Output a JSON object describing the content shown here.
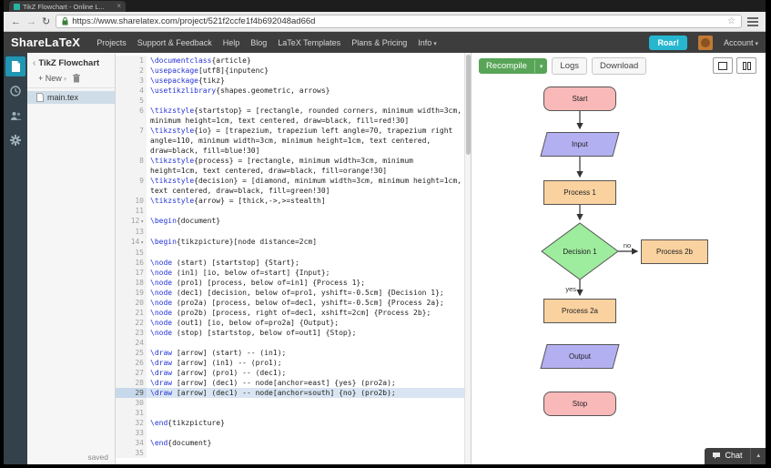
{
  "browser": {
    "tab_title": "TikZ Flowchart - Online L...",
    "url": "https://www.sharelatex.com/project/521f2ccfe1f4b692048ad66d"
  },
  "navbar": {
    "brand": "ShareLaTeX",
    "menu": [
      "Projects",
      "Support & Feedback",
      "Help",
      "Blog",
      "LaTeX Templates",
      "Plans & Pricing",
      "Info"
    ],
    "roar": "Roar!",
    "account": "Account"
  },
  "sidebar": {
    "icons": [
      "files",
      "history",
      "collaborators",
      "settings"
    ]
  },
  "file_panel": {
    "project_name": "TikZ Flowchart",
    "new_button": "+ New",
    "files": [
      "main.tex"
    ],
    "save_status": "saved"
  },
  "editor": {
    "active_line": 29,
    "lines": [
      {
        "n": 1,
        "t": "\\documentclass{article}"
      },
      {
        "n": 2,
        "t": "\\usepackage[utf8]{inputenc}"
      },
      {
        "n": 3,
        "t": "\\usepackage{tikz}"
      },
      {
        "n": 4,
        "t": "\\usetikzlibrary{shapes.geometric, arrows}"
      },
      {
        "n": 5,
        "t": ""
      },
      {
        "n": 6,
        "t": "\\tikzstyle{startstop} = [rectangle, rounded corners, minimum width=3cm, minimum height=1cm, text centered, draw=black, fill=red!30]"
      },
      {
        "n": 7,
        "t": "\\tikzstyle{io} = [trapezium, trapezium left angle=70, trapezium right angle=110, minimum width=3cm, minimum height=1cm, text centered, draw=black, fill=blue!30]"
      },
      {
        "n": 8,
        "t": "\\tikzstyle{process} = [rectangle, minimum width=3cm, minimum height=1cm, text centered, draw=black, fill=orange!30]"
      },
      {
        "n": 9,
        "t": "\\tikzstyle{decision} = [diamond, minimum width=3cm, minimum height=1cm, text centered, draw=black, fill=green!30]"
      },
      {
        "n": 10,
        "t": "\\tikzstyle{arrow} = [thick,->,>=stealth]"
      },
      {
        "n": 11,
        "t": ""
      },
      {
        "n": 12,
        "t": "\\begin{document}",
        "fold": true
      },
      {
        "n": 13,
        "t": ""
      },
      {
        "n": 14,
        "t": "\\begin{tikzpicture}[node distance=2cm]",
        "fold": true
      },
      {
        "n": 15,
        "t": ""
      },
      {
        "n": 16,
        "t": "\\node (start) [startstop] {Start};"
      },
      {
        "n": 17,
        "t": "\\node (in1) [io, below of=start] {Input};"
      },
      {
        "n": 18,
        "t": "\\node (pro1) [process, below of=in1] {Process 1};"
      },
      {
        "n": 19,
        "t": "\\node (dec1) [decision, below of=pro1, yshift=-0.5cm] {Decision 1};"
      },
      {
        "n": 20,
        "t": "\\node (pro2a) [process, below of=dec1, yshift=-0.5cm] {Process 2a};"
      },
      {
        "n": 21,
        "t": "\\node (pro2b) [process, right of=dec1, xshift=2cm] {Process 2b};"
      },
      {
        "n": 22,
        "t": "\\node (out1) [io, below of=pro2a] {Output};"
      },
      {
        "n": 23,
        "t": "\\node (stop) [startstop, below of=out1] {Stop};"
      },
      {
        "n": 24,
        "t": ""
      },
      {
        "n": 25,
        "t": "\\draw [arrow] (start) -- (in1);"
      },
      {
        "n": 26,
        "t": "\\draw [arrow] (in1) -- (pro1);"
      },
      {
        "n": 27,
        "t": "\\draw [arrow] (pro1) -- (dec1);"
      },
      {
        "n": 28,
        "t": "\\draw [arrow] (dec1) -- node[anchor=east] {yes} (pro2a);"
      },
      {
        "n": 29,
        "t": "\\draw [arrow] (dec1) -- node[anchor=south] {no} (pro2b);"
      },
      {
        "n": 30,
        "t": ""
      },
      {
        "n": 31,
        "t": ""
      },
      {
        "n": 32,
        "t": "\\end{tikzpicture}"
      },
      {
        "n": 33,
        "t": ""
      },
      {
        "n": 34,
        "t": "\\end{document}"
      },
      {
        "n": 35,
        "t": ""
      }
    ]
  },
  "preview": {
    "recompile": "Recompile",
    "logs": "Logs",
    "download": "Download",
    "chat": "Chat"
  },
  "flowchart": {
    "nodes": [
      {
        "id": "start",
        "label": "Start",
        "shape": "rounded-rect",
        "fill": "#f9b9b9"
      },
      {
        "id": "in1",
        "label": "Input",
        "shape": "parallelogram",
        "fill": "#b3b0f2"
      },
      {
        "id": "pro1",
        "label": "Process 1",
        "shape": "rect",
        "fill": "#fad2a0"
      },
      {
        "id": "dec1",
        "label": "Decision 1",
        "shape": "diamond",
        "fill": "#9eec9e"
      },
      {
        "id": "pro2b",
        "label": "Process 2b",
        "shape": "rect",
        "fill": "#fad2a0"
      },
      {
        "id": "pro2a",
        "label": "Process 2a",
        "shape": "rect",
        "fill": "#fad2a0"
      },
      {
        "id": "out1",
        "label": "Output",
        "shape": "parallelogram",
        "fill": "#b3b0f2"
      },
      {
        "id": "stop",
        "label": "Stop",
        "shape": "rounded-rect",
        "fill": "#f9b9b9"
      }
    ],
    "edges": [
      {
        "from": "start",
        "to": "in1",
        "label": ""
      },
      {
        "from": "in1",
        "to": "pro1",
        "label": ""
      },
      {
        "from": "pro1",
        "to": "dec1",
        "label": ""
      },
      {
        "from": "dec1",
        "to": "pro2a",
        "label": "yes"
      },
      {
        "from": "dec1",
        "to": "pro2b",
        "label": "no"
      }
    ]
  },
  "colors": {
    "accent_teal": "#26b6cf",
    "recompile_green": "#58a558",
    "navbar_bg": "#3d3d3d"
  }
}
